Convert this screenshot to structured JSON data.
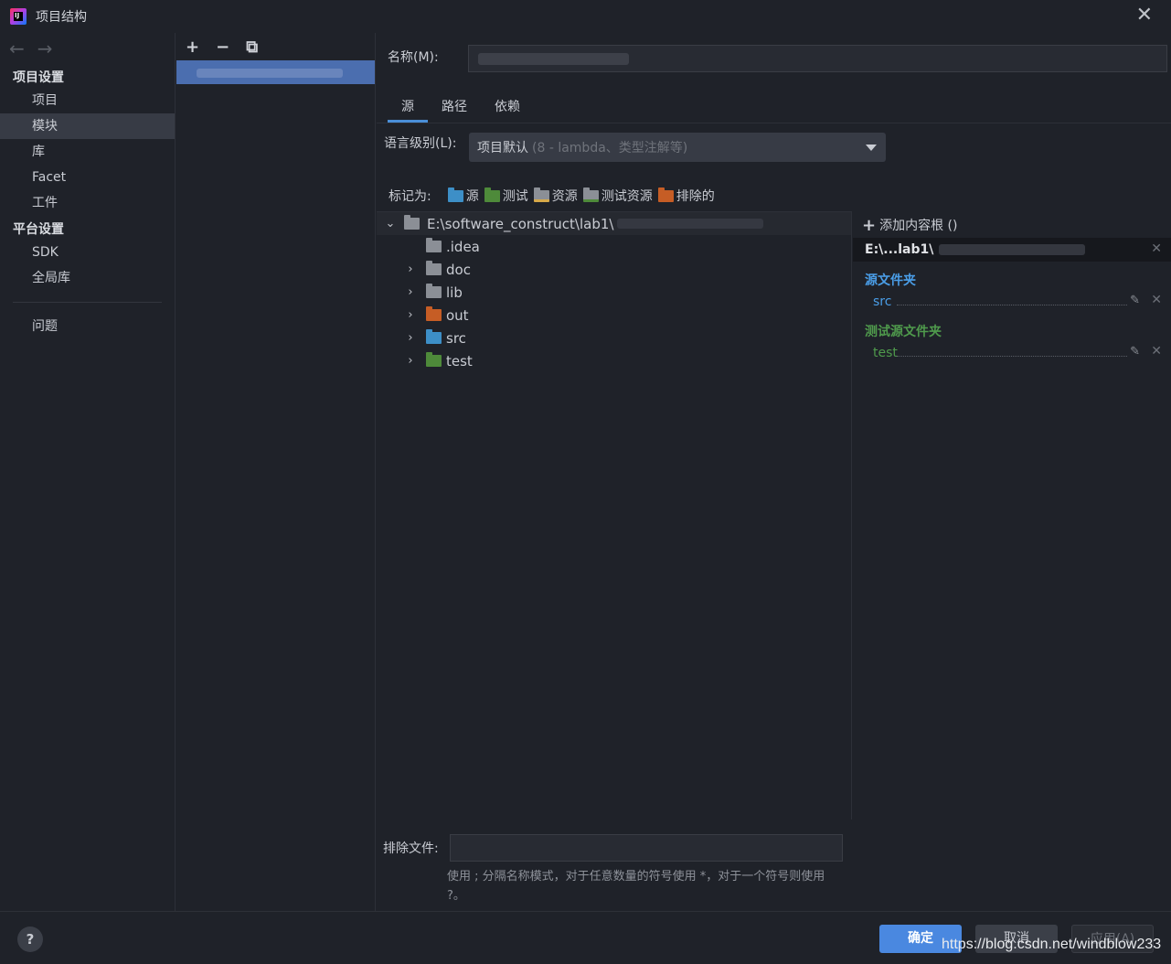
{
  "window": {
    "title": "项目结构",
    "close": "✕"
  },
  "nav": {
    "back": "←",
    "forward": "→",
    "section_project": "项目设置",
    "items_project": [
      "项目",
      "模块",
      "库",
      "Facet",
      "工件"
    ],
    "section_platform": "平台设置",
    "items_platform": [
      "SDK",
      "全局库"
    ],
    "items_other": [
      "问题"
    ]
  },
  "modules": {
    "add": "+",
    "remove": "−",
    "copy": "⧉"
  },
  "name": {
    "label": "名称(M):"
  },
  "tabs": [
    "源",
    "路径",
    "依赖"
  ],
  "language": {
    "label": "语言级别(L):",
    "value": "项目默认",
    "hint": "(8 - lambda、类型注解等)"
  },
  "mark_as": {
    "label": "标记为:",
    "items": [
      "源",
      "测试",
      "资源",
      "测试资源",
      "排除的"
    ]
  },
  "tree": {
    "root": "E:\\software_construct\\lab1\\",
    "children": [
      ".idea",
      "doc",
      "lib",
      "out",
      "src",
      "test"
    ]
  },
  "content_roots": {
    "add": "添加内容根 ()",
    "root_label": "E:\\...lab1\\",
    "source_title": "源文件夹",
    "source_item": "src",
    "test_title": "测试源文件夹",
    "test_item": "test"
  },
  "exclude": {
    "label": "排除文件:",
    "hint": "使用 ; 分隔名称模式，对于任意数量的符号使用 *，对于一个符号则使用 ?。"
  },
  "buttons": {
    "help": "?",
    "ok": "确定",
    "cancel": "取消",
    "apply": "应用(A)"
  },
  "watermark": "https://blog.csdn.net/windblow233",
  "colors": {
    "accent": "#4a88e0",
    "source": "#3d8fc7",
    "test": "#4e8a3a",
    "excluded": "#c65d25"
  }
}
